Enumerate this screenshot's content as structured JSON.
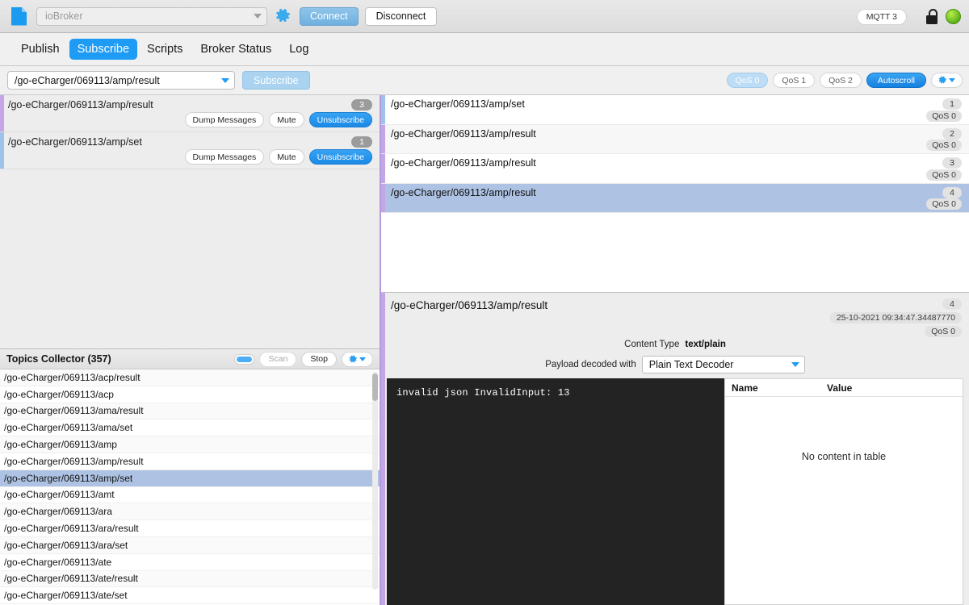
{
  "toolbar": {
    "file_icon": "file-icon",
    "broker_placeholder": "ioBroker",
    "gear_icon": "gear-icon",
    "connect_label": "Connect",
    "disconnect_label": "Disconnect",
    "protocol_badge": "MQTT 3",
    "lock_icon": "unlocked-padlock-icon",
    "status_led": "connected-status-led",
    "accent_color": "#1d9bf5",
    "status_color": "#6cc11f"
  },
  "nav": {
    "tabs": [
      {
        "label": "Publish",
        "active": false
      },
      {
        "label": "Subscribe",
        "active": true
      },
      {
        "label": "Scripts",
        "active": false
      },
      {
        "label": "Broker Status",
        "active": false
      },
      {
        "label": "Log",
        "active": false
      }
    ]
  },
  "subscribe_bar": {
    "topic_value": "/go-eCharger/069113/amp/result",
    "subscribe_label": "Subscribe",
    "qos_options": [
      {
        "label": "QoS 0",
        "selected": true
      },
      {
        "label": "QoS 1",
        "selected": false
      },
      {
        "label": "QoS 2",
        "selected": false
      }
    ],
    "autoscroll_label": "Autoscroll",
    "autoscroll_active": true,
    "settings_icon": "gear-dropdown-icon"
  },
  "subscriptions": {
    "items": [
      {
        "topic": "/go-eCharger/069113/amp/result",
        "count": "3",
        "color": "#c4a5e6",
        "dump_label": "Dump Messages",
        "mute_label": "Mute",
        "unsubscribe_label": "Unsubscribe"
      },
      {
        "topic": "/go-eCharger/069113/amp/set",
        "count": "1",
        "color": "#9ec3ea",
        "dump_label": "Dump Messages",
        "mute_label": "Mute",
        "unsubscribe_label": "Unsubscribe"
      }
    ]
  },
  "topics_collector": {
    "title": "Topics Collector (357)",
    "toggle_on": true,
    "scan_label": "Scan",
    "scan_enabled": false,
    "stop_label": "Stop",
    "settings_icon": "gear-dropdown-icon",
    "topics": [
      {
        "topic": "/go-eCharger/069113/acp/result",
        "selected": false
      },
      {
        "topic": "/go-eCharger/069113/acp",
        "selected": false
      },
      {
        "topic": "/go-eCharger/069113/ama/result",
        "selected": false
      },
      {
        "topic": "/go-eCharger/069113/ama/set",
        "selected": false
      },
      {
        "topic": "/go-eCharger/069113/amp",
        "selected": false
      },
      {
        "topic": "/go-eCharger/069113/amp/result",
        "selected": false
      },
      {
        "topic": "/go-eCharger/069113/amp/set",
        "selected": true
      },
      {
        "topic": "/go-eCharger/069113/amt",
        "selected": false
      },
      {
        "topic": "/go-eCharger/069113/ara",
        "selected": false
      },
      {
        "topic": "/go-eCharger/069113/ara/result",
        "selected": false
      },
      {
        "topic": "/go-eCharger/069113/ara/set",
        "selected": false
      },
      {
        "topic": "/go-eCharger/069113/ate",
        "selected": false
      },
      {
        "topic": "/go-eCharger/069113/ate/result",
        "selected": false
      },
      {
        "topic": "/go-eCharger/069113/ate/set",
        "selected": false
      }
    ]
  },
  "messages": {
    "items": [
      {
        "topic": "/go-eCharger/069113/amp/set",
        "index": "1",
        "qos": "QoS 0",
        "color": "#9ec3ea",
        "selected": false
      },
      {
        "topic": "/go-eCharger/069113/amp/result",
        "index": "2",
        "qos": "QoS 0",
        "color": "#c4a5e6",
        "selected": false
      },
      {
        "topic": "/go-eCharger/069113/amp/result",
        "index": "3",
        "qos": "QoS 0",
        "color": "#c4a5e6",
        "selected": false
      },
      {
        "topic": "/go-eCharger/069113/amp/result",
        "index": "4",
        "qos": "QoS 0",
        "color": "#c4a5e6",
        "selected": true
      }
    ]
  },
  "detail": {
    "topic": "/go-eCharger/069113/amp/result",
    "index": "4",
    "timestamp": "25-10-2021  09:34:47.34487770",
    "qos": "QoS 0",
    "content_type_label": "Content Type",
    "content_type_value": "text/plain",
    "decoder_label": "Payload decoded with",
    "decoder_value": "Plain Text Decoder",
    "payload": "invalid json InvalidInput: 13",
    "properties": {
      "col_name": "Name",
      "col_value": "Value",
      "empty_text": "No content in table"
    }
  }
}
